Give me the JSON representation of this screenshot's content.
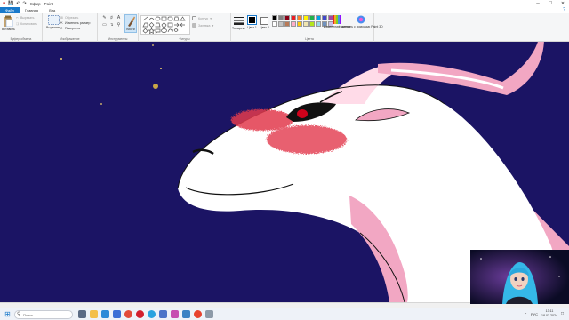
{
  "titlebar": {
    "title": "Сфир - Paint",
    "qat_icons": [
      "save-icon",
      "undo-icon",
      "redo-icon"
    ],
    "window_buttons": [
      "─",
      "☐",
      "✕"
    ]
  },
  "menu": {
    "tabs": [
      "Файл",
      "Главная",
      "Вид"
    ],
    "help_glyph": "?"
  },
  "ribbon": {
    "clipboard": {
      "label": "Буфер обмена",
      "paste": "Вставить",
      "cut": "Вырезать",
      "copy": "Копировать"
    },
    "image": {
      "label": "Изображение",
      "select": "Выделить",
      "crop": "Обрезать",
      "resize": "Изменить размер",
      "rotate": "Повернуть"
    },
    "tools": {
      "label": "Инструменты",
      "brushes": "Кисти"
    },
    "shapes": {
      "label": "Фигуры",
      "outline": "Контур",
      "fill": "Заливка"
    },
    "size": {
      "label": "Толщина"
    },
    "colors": {
      "label": "Цвета",
      "color1": "Цвет 1",
      "color2": "Цвет 2",
      "edit": "Изменение цветов",
      "paint3d": "Изменить с помощью Paint 3D",
      "color1_value": "#000000",
      "color2_value": "#ffffff",
      "palette": [
        "#000000",
        "#7f7f7f",
        "#880015",
        "#ed1c24",
        "#ff7f27",
        "#fff200",
        "#22b14c",
        "#00a2e8",
        "#3f48cc",
        "#a349a4",
        "#ffffff",
        "#c3c3c3",
        "#b97a57",
        "#ffaec9",
        "#ffc90e",
        "#efe4b0",
        "#b5e61d",
        "#99d9ea",
        "#7092be",
        "#c8bfe7"
      ]
    }
  },
  "canvas": {
    "background": "#1b1464",
    "dragon_body": "#ffffff",
    "dragon_pink": "#f2a7c3",
    "blush": "#e23a4e",
    "eye": "#d0021b"
  },
  "taskbar": {
    "search_placeholder": "Поиск",
    "apps": [
      "task-view-icon",
      "explorer-icon",
      "edge-icon",
      "store-icon",
      "chrome-icon",
      "opera-icon",
      "telegram-icon",
      "photos-icon",
      "paint-icon",
      "mail-icon",
      "yandex-icon",
      "files-icon"
    ],
    "lang": "РУС",
    "time": "13:11",
    "date": "18.03.2024"
  }
}
